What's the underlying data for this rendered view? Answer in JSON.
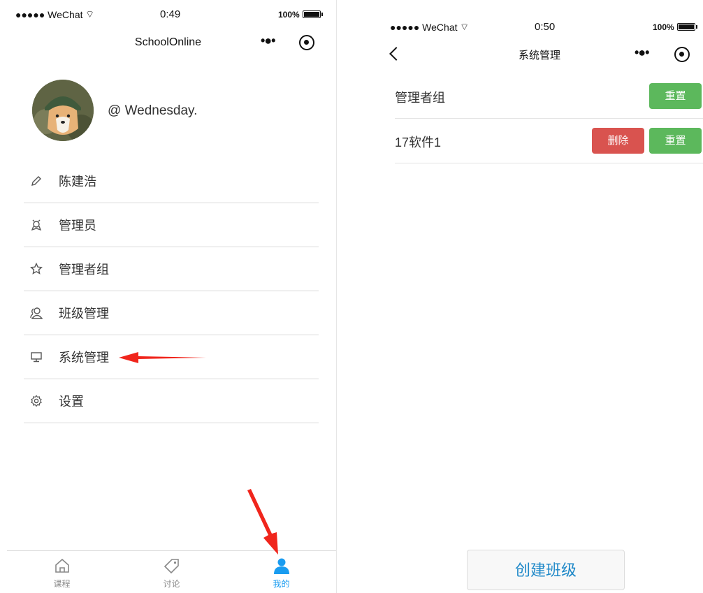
{
  "left_screen": {
    "status": {
      "carrier": "●●●●● WeChat",
      "time": "0:49",
      "battery": "100%"
    },
    "nav": {
      "title": "SchoolOnline"
    },
    "profile": {
      "username": "@ Wednesday."
    },
    "menu": [
      {
        "label": "陈建浩",
        "icon": "pencil-icon"
      },
      {
        "label": "管理员",
        "icon": "award-icon"
      },
      {
        "label": "管理者组",
        "icon": "star-icon"
      },
      {
        "label": "班级管理",
        "icon": "users-icon"
      },
      {
        "label": "系统管理",
        "icon": "monitor-icon"
      },
      {
        "label": "设置",
        "icon": "gear-icon"
      }
    ],
    "tabbar": [
      {
        "label": "课程",
        "icon": "home-icon",
        "active": false
      },
      {
        "label": "讨论",
        "icon": "tag-icon",
        "active": false
      },
      {
        "label": "我的",
        "icon": "person-icon",
        "active": true
      }
    ]
  },
  "right_screen": {
    "status": {
      "carrier": "●●●●● WeChat",
      "time": "0:50",
      "battery": "100%"
    },
    "nav": {
      "title": "系统管理"
    },
    "rows": [
      {
        "label": "管理者组",
        "delete_label": "",
        "reset_label": "重置"
      },
      {
        "label": "17软件1",
        "delete_label": "删除",
        "reset_label": "重置"
      }
    ],
    "create_button": "创建班级"
  },
  "colors": {
    "green": "#5cb85c",
    "red": "#d9534f",
    "active_tab": "#1a9cf0",
    "annotation_arrow": "#f0251c"
  }
}
